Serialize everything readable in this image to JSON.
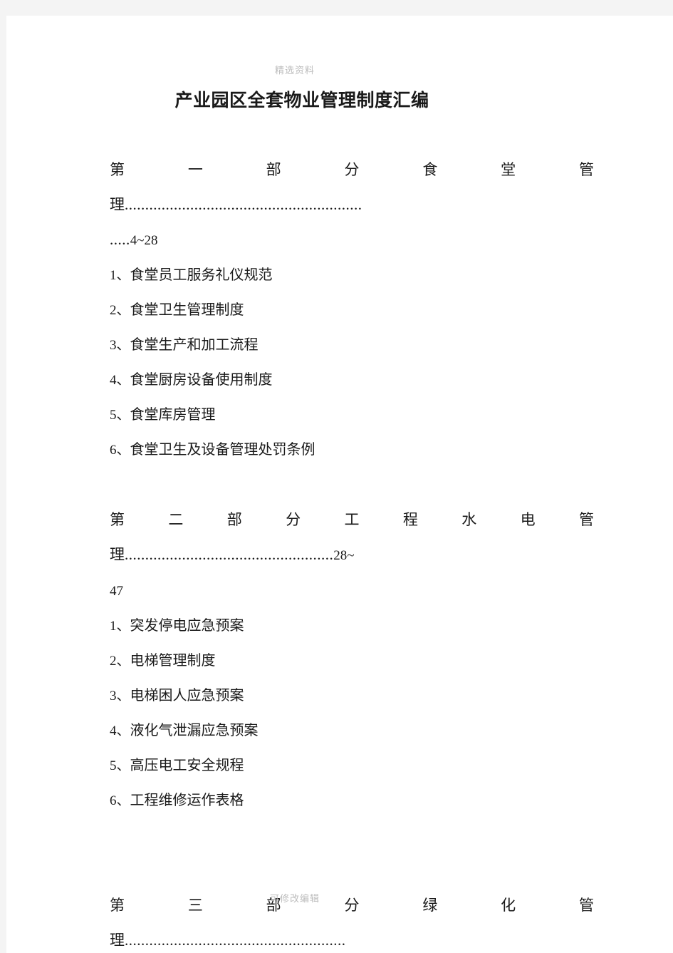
{
  "page": {
    "watermark_top": "精选资料",
    "watermark_bottom": "可修改编辑",
    "title": "产业园区全套物业管理制度汇编"
  },
  "sections": [
    {
      "heading_left": "第 一 部 分",
      "heading_left_chars": [
        "第",
        "一",
        "部",
        "分"
      ],
      "heading_right_chars": [
        "食",
        "堂",
        "管"
      ],
      "heading_wrap_char": "理",
      "heading_full": "第一部分  食堂管理",
      "leader_line1": "..........................................................",
      "leader_line2": ".....",
      "page_range": "4~28",
      "items": [
        {
          "num": "1、",
          "text": "食堂员工服务礼仪规范"
        },
        {
          "num": "2、",
          "text": "食堂卫生管理制度"
        },
        {
          "num": "3、",
          "text": "食堂生产和加工流程"
        },
        {
          "num": "4、",
          "text": "食堂厨房设备使用制度"
        },
        {
          "num": "5、",
          "text": "食堂库房管理"
        },
        {
          "num": "6、",
          "text": "食堂卫生及设备管理处罚条例"
        }
      ]
    },
    {
      "heading_left": "第 二 部 分",
      "heading_left_chars": [
        "第",
        "二",
        "部",
        "分"
      ],
      "heading_right_chars": [
        "工",
        "程",
        "水",
        "电",
        "管"
      ],
      "heading_wrap_char": "理",
      "heading_full": "第二部分  工程水电管理",
      "leader_line1": "...................................................",
      "leader_line2": "",
      "page_range_inline": "28~",
      "page_range_wrap": "47",
      "page_range": "28~47",
      "items": [
        {
          "num": "1、",
          "text": "突发停电应急预案"
        },
        {
          "num": "2、",
          "text": "电梯管理制度"
        },
        {
          "num": "3、",
          "text": "电梯困人应急预案"
        },
        {
          "num": "4、",
          "text": "液化气泄漏应急预案"
        },
        {
          "num": "5、",
          "text": "高压电工安全规程"
        },
        {
          "num": "6、",
          "text": "工程维修运作表格"
        }
      ]
    },
    {
      "heading_left": "第 三 部 分",
      "heading_left_chars": [
        "第",
        "三",
        "部",
        "分"
      ],
      "heading_right_chars": [
        "绿",
        "化",
        "管"
      ],
      "heading_wrap_char": "理",
      "heading_full": "第三部分  绿化管理",
      "leader_line1": "......................................................",
      "leader_line2": "",
      "page_range": "",
      "items": []
    }
  ]
}
